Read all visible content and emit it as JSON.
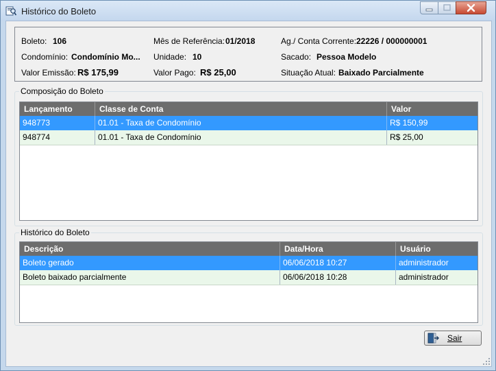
{
  "window": {
    "title": "Histórico do Boleto",
    "icon": "boleto-history-icon",
    "controls": [
      "minimize-icon",
      "maximize-icon",
      "close-icon"
    ]
  },
  "info": {
    "boleto_label": "Boleto:",
    "boleto_value": "106",
    "mes_label": "Mês de Referência:",
    "mes_value": "01/2018",
    "conta_label": "Ag./ Conta Corrente:",
    "conta_value": "22226 / 000000001",
    "condominio_label": "Condomínio:",
    "condominio_value": "Condomínio Mo...",
    "unidade_label": "Unidade:",
    "unidade_value": "10",
    "sacado_label": "Sacado:",
    "sacado_value": "Pessoa Modelo",
    "emissao_label": "Valor Emissão:",
    "emissao_value": "R$ 175,99",
    "pago_label": "Valor Pago:",
    "pago_value": "R$ 25,00",
    "situacao_label": "Situação Atual:",
    "situacao_value": "Baixado Parcialmente"
  },
  "composicao": {
    "title": "Composição do Boleto",
    "columns": [
      "Lançamento",
      "Classe de Conta",
      "Valor"
    ],
    "rows": [
      [
        "948773",
        "01.01 - Taxa de Condomínio",
        "R$ 150,99"
      ],
      [
        "948774",
        "01.01 - Taxa de Condomínio",
        "R$ 25,00"
      ]
    ]
  },
  "historico": {
    "title": "Histórico do Boleto",
    "columns": [
      "Descrição",
      "Data/Hora",
      "Usuário"
    ],
    "rows": [
      [
        "Boleto  gerado",
        "06/06/2018 10:27",
        "administrador"
      ],
      [
        "Boleto baixado parcialmente",
        "06/06/2018 10:28",
        "administrador"
      ]
    ]
  },
  "footer": {
    "sair_label": "Sair",
    "sair_icon": "exit-door-icon"
  },
  "colors": {
    "selected_row": "#3399ff",
    "alt_row": "#eaf7ea",
    "grid_header": "#6d6d6d",
    "title_bar": "#c4d7ee",
    "close_button": "#c74a32"
  }
}
